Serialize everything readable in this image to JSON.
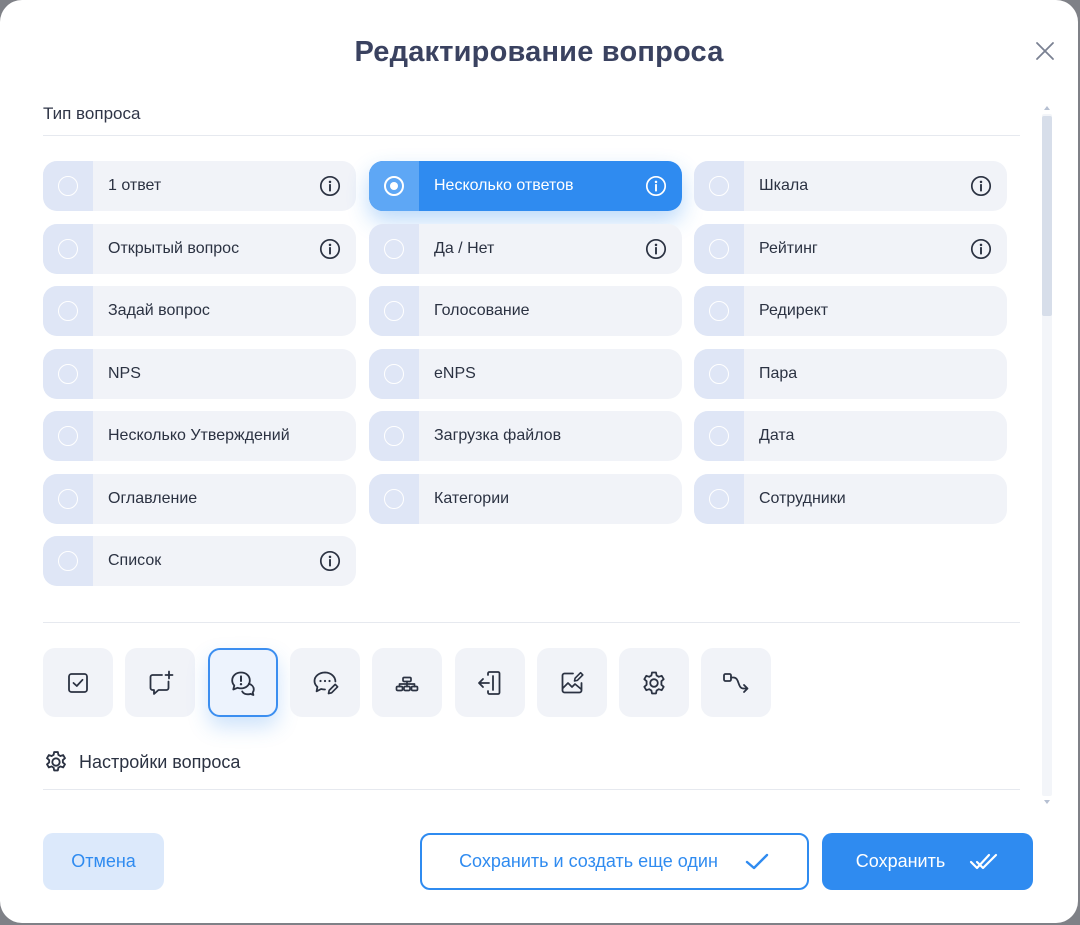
{
  "modal": {
    "title": "Редактирование вопроса"
  },
  "question_type": {
    "label": "Тип вопроса",
    "options": [
      {
        "label": "1 ответ",
        "info": true,
        "selected": false
      },
      {
        "label": "Несколько ответов",
        "info": true,
        "selected": true
      },
      {
        "label": "Шкала",
        "info": true,
        "selected": false
      },
      {
        "label": "Открытый вопрос",
        "info": true,
        "selected": false
      },
      {
        "label": "Да / Нет",
        "info": true,
        "selected": false
      },
      {
        "label": "Рейтинг",
        "info": true,
        "selected": false
      },
      {
        "label": "Задай вопрос",
        "info": false,
        "selected": false
      },
      {
        "label": "Голосование",
        "info": false,
        "selected": false
      },
      {
        "label": "Редирект",
        "info": false,
        "selected": false
      },
      {
        "label": "NPS",
        "info": false,
        "selected": false
      },
      {
        "label": "eNPS",
        "info": false,
        "selected": false
      },
      {
        "label": "Пара",
        "info": false,
        "selected": false
      },
      {
        "label": "Несколько Утверждений",
        "info": false,
        "selected": false
      },
      {
        "label": "Загрузка файлов",
        "info": false,
        "selected": false
      },
      {
        "label": "Дата",
        "info": false,
        "selected": false
      },
      {
        "label": "Оглавление",
        "info": false,
        "selected": false
      },
      {
        "label": "Категории",
        "info": false,
        "selected": false
      },
      {
        "label": "Сотрудники",
        "info": false,
        "selected": false
      },
      {
        "label": "Список",
        "info": true,
        "selected": false
      }
    ]
  },
  "toolbar": {
    "tools": [
      {
        "icon": "checkbox-icon",
        "active": false
      },
      {
        "icon": "add-comment-icon",
        "active": false
      },
      {
        "icon": "chat-alert-icon",
        "active": true
      },
      {
        "icon": "chat-edit-icon",
        "active": false
      },
      {
        "icon": "hierarchy-icon",
        "active": false
      },
      {
        "icon": "exit-door-icon",
        "active": false
      },
      {
        "icon": "image-edit-icon",
        "active": false
      },
      {
        "icon": "gear-icon",
        "active": false
      },
      {
        "icon": "route-icon",
        "active": false
      }
    ]
  },
  "settings": {
    "label": "Настройки вопроса"
  },
  "footer": {
    "cancel_label": "Отмена",
    "save_and_new_label": "Сохранить и создать еще один",
    "save_label": "Сохранить"
  },
  "colors": {
    "accent": "#2f8bf0",
    "title": "#3a4260",
    "option_bg": "#f1f3f8",
    "radio_cell_bg": "#dfe6f6"
  }
}
